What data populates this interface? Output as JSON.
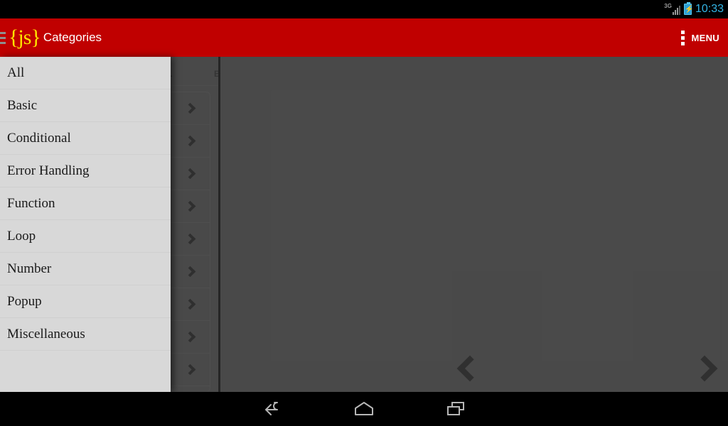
{
  "status_bar": {
    "network_label": "3G",
    "network_icon": "signal-bars-icon",
    "battery_icon": "battery-charging-icon",
    "time": "10:33",
    "time_color": "#33b5e5"
  },
  "app_bar": {
    "drawer_toggle_icon": "hamburger-menu-icon",
    "brand_open": "{",
    "brand_text": "js",
    "brand_close": "}",
    "brand_color": "#ffe400",
    "title": "Categories",
    "background_color": "#c00000",
    "overflow_icon": "overflow-menu-icon",
    "menu_label": "MENU"
  },
  "drawer": {
    "background_color": "#d8d8d8",
    "items": [
      {
        "label": "All"
      },
      {
        "label": "Basic"
      },
      {
        "label": "Conditional"
      },
      {
        "label": "Error Handling"
      },
      {
        "label": "Function"
      },
      {
        "label": "Loop"
      },
      {
        "label": "Number"
      },
      {
        "label": "Popup"
      },
      {
        "label": "Miscellaneous"
      }
    ]
  },
  "content": {
    "scrim_color": "#5e5e5e",
    "tabs": [
      {
        "label": "AL"
      },
      {
        "label": "B"
      }
    ],
    "list_rows": [
      {
        "chevron_icon": "chevron-right-icon"
      },
      {
        "chevron_icon": "chevron-right-icon"
      },
      {
        "chevron_icon": "chevron-right-icon"
      },
      {
        "chevron_icon": "chevron-right-icon"
      },
      {
        "chevron_icon": "chevron-right-icon"
      },
      {
        "chevron_icon": "chevron-right-icon"
      },
      {
        "chevron_icon": "chevron-right-icon"
      },
      {
        "chevron_icon": "chevron-right-icon"
      },
      {
        "chevron_icon": "chevron-right-icon"
      }
    ],
    "prev_icon": "chevron-left-icon",
    "next_icon": "chevron-right-icon"
  },
  "nav_bar": {
    "back_icon": "back-arrow-icon",
    "home_icon": "home-icon",
    "recents_icon": "recent-apps-icon",
    "background_color": "#000000"
  }
}
